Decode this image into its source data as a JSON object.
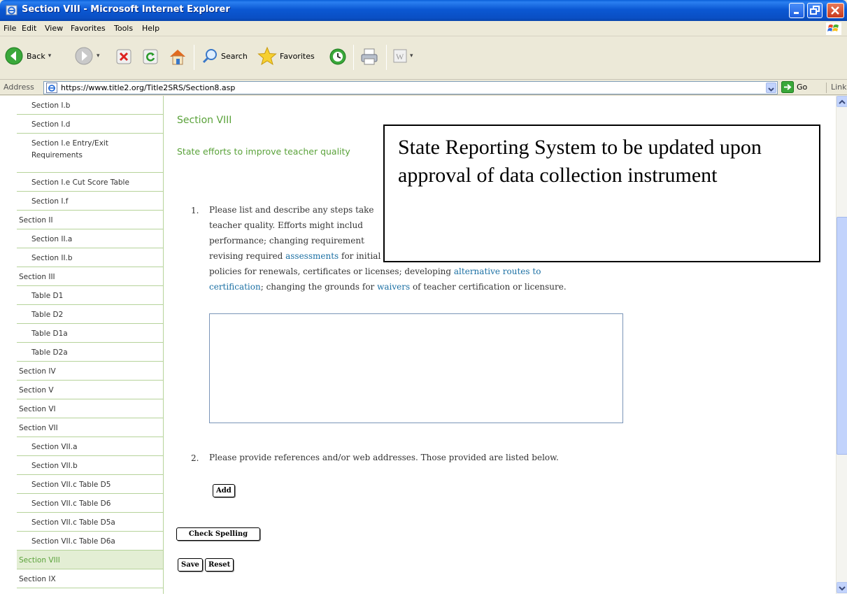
{
  "window": {
    "title": "Section VIII - Microsoft Internet Explorer"
  },
  "menu": [
    "File",
    "Edit",
    "View",
    "Favorites",
    "Tools",
    "Help"
  ],
  "toolbar": {
    "back": "Back",
    "search": "Search",
    "favorites": "Favorites"
  },
  "address": {
    "label": "Address",
    "url": "https://www.title2.org/Title2SRS/Section8.asp",
    "go": "Go",
    "links": "Links"
  },
  "nav": [
    {
      "label": "Section I.b"
    },
    {
      "label": "Section I.d"
    },
    {
      "label": "Section I.e Entry/Exit Requirements"
    },
    {
      "label": "Section I.e Cut Score Table"
    },
    {
      "label": "Section I.f"
    },
    {
      "label": "Section II"
    },
    {
      "label": "Section II.a"
    },
    {
      "label": "Section II.b"
    },
    {
      "label": "Section III"
    },
    {
      "label": "Table D1"
    },
    {
      "label": "Table D2"
    },
    {
      "label": "Table D1a"
    },
    {
      "label": "Table D2a"
    },
    {
      "label": "Section IV"
    },
    {
      "label": "Section V"
    },
    {
      "label": "Section VI"
    },
    {
      "label": "Section VII"
    },
    {
      "label": "Section VII.a"
    },
    {
      "label": "Section VII.b"
    },
    {
      "label": "Section VII.c Table D5"
    },
    {
      "label": "Section VII.c Table D6"
    },
    {
      "label": "Section VII.c Table D5a"
    },
    {
      "label": "Section VII.c Table D6a"
    },
    {
      "label": "Section VIII"
    },
    {
      "label": "Section IX"
    }
  ],
  "main": {
    "title": "Section VIII",
    "subtitle": "State efforts to improve teacher quality",
    "q1": {
      "num": "1.",
      "line1": "Please list and describe any steps take",
      "line2": "teacher quality. Efforts might includ",
      "line3": "performance; changing requirement",
      "line4_a": "revising required ",
      "line4_link": "assessments",
      "line4_b": " for initial teacher certification or licensure; modifying",
      "line5_a": "policies for renewals, certificates or licenses; developing ",
      "line5_link": "alternative routes to",
      "line6_link": "certification",
      "line6_b": "; changing the grounds for ",
      "line6_link2": "waivers",
      "line6_c": " of teacher certification or licensure.",
      "answer": ""
    },
    "q2": {
      "num": "2.",
      "text": "Please provide references and/or web addresses. Those provided are listed below."
    },
    "buttons": {
      "add": "Add",
      "check_spelling": "Check Spelling",
      "save": "Save",
      "reset": "Reset"
    }
  },
  "overlay": {
    "text": "State Reporting System to be updated upon approval of data collection instrument"
  }
}
